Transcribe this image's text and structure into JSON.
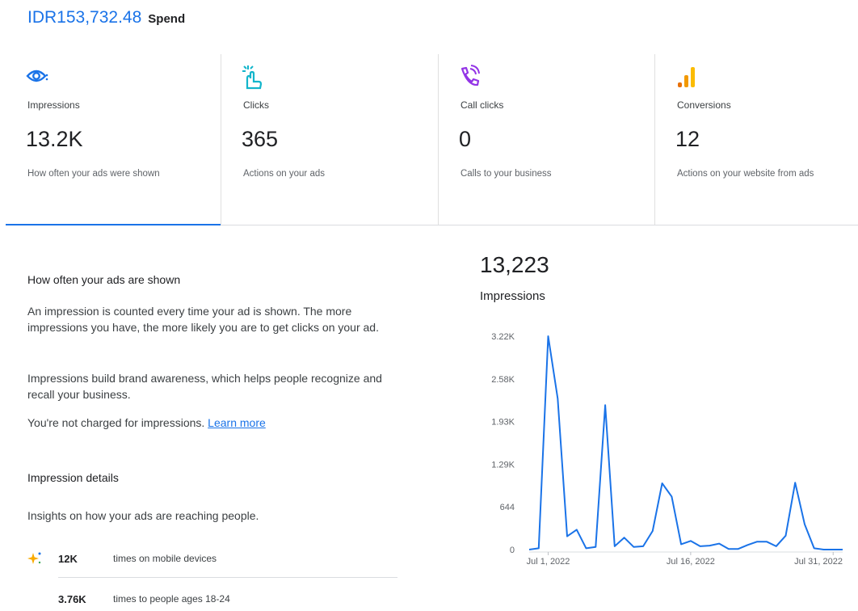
{
  "spend": {
    "amount": "IDR153,732.48",
    "label": "Spend"
  },
  "cards": [
    {
      "icon": "eye-icon",
      "title": "Impressions",
      "value": "13.2K",
      "desc": "How often your ads were shown",
      "selected": true
    },
    {
      "icon": "tap-icon",
      "title": "Clicks",
      "value": "365",
      "desc": "Actions on your ads"
    },
    {
      "icon": "phone-call-icon",
      "title": "Call clicks",
      "value": "0",
      "desc": "Calls to your business"
    },
    {
      "icon": "bar-chart-icon",
      "title": "Conversions",
      "value": "12",
      "desc": "Actions on your website from ads"
    }
  ],
  "details": {
    "title": "How often your ads are shown",
    "p1": "An impression is counted every time your ad is shown. The more impressions you have, the more likely you are to get clicks on your ad.",
    "p2": "Impressions build brand awareness, which helps people recognize and recall your business.",
    "p3": "You're not charged for impressions.",
    "learn_more": "Learn more",
    "impression_details_title": "Impression details",
    "insights": "Insights on how your ads are reaching people.",
    "rows": [
      {
        "value": "12K",
        "text": "times on mobile devices"
      },
      {
        "value": "3.76K",
        "text": "times to people ages 18-24"
      }
    ]
  },
  "chart_header": {
    "total": "13,223",
    "label": "Impressions"
  },
  "chart_data": {
    "type": "line",
    "title": "",
    "xlabel": "",
    "ylabel": "",
    "x_tick_labels": [
      "Jul 1, 2022",
      "Jul 16, 2022",
      "Jul 31, 2022"
    ],
    "y_tick_labels": [
      "0",
      "644",
      "1.29K",
      "1.93K",
      "2.58K",
      "3.22K"
    ],
    "ylim": [
      0,
      3220
    ],
    "grid": false,
    "colors": {
      "line": "#1a73e8"
    },
    "x": [
      "2022-06-29",
      "2022-06-30",
      "2022-07-01",
      "2022-07-02",
      "2022-07-03",
      "2022-07-04",
      "2022-07-05",
      "2022-07-06",
      "2022-07-07",
      "2022-07-08",
      "2022-07-09",
      "2022-07-10",
      "2022-07-11",
      "2022-07-12",
      "2022-07-13",
      "2022-07-14",
      "2022-07-15",
      "2022-07-16",
      "2022-07-17",
      "2022-07-18",
      "2022-07-19",
      "2022-07-20",
      "2022-07-21",
      "2022-07-22",
      "2022-07-23",
      "2022-07-24",
      "2022-07-25",
      "2022-07-26",
      "2022-07-27",
      "2022-07-28",
      "2022-07-29",
      "2022-07-30",
      "2022-07-31",
      "2022-08-01"
    ],
    "series": [
      {
        "values": [
          0,
          20,
          3220,
          2280,
          200,
          300,
          20,
          40,
          2180,
          50,
          180,
          40,
          50,
          280,
          1000,
          800,
          80,
          130,
          50,
          60,
          90,
          10,
          10,
          70,
          120,
          120,
          50,
          210,
          1010,
          380,
          20,
          0,
          0,
          0
        ]
      }
    ]
  }
}
